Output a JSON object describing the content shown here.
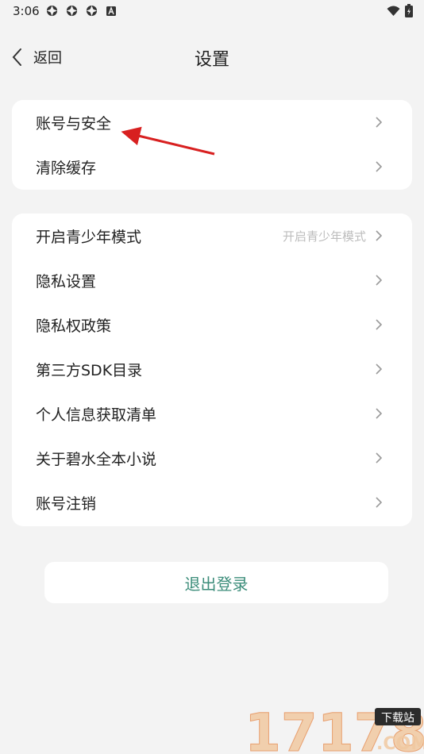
{
  "status": {
    "time": "3:06",
    "icons": [
      "notification-icon",
      "notification-icon",
      "notification-icon",
      "a-icon",
      "wifi-icon",
      "battery-icon"
    ]
  },
  "header": {
    "back_label": "返回",
    "title": "设置"
  },
  "group1": {
    "items": [
      {
        "label": "账号与安全"
      },
      {
        "label": "清除缓存"
      }
    ]
  },
  "group2": {
    "items": [
      {
        "label": "开启青少年模式",
        "value": "开启青少年模式"
      },
      {
        "label": "隐私设置"
      },
      {
        "label": "隐私权政策"
      },
      {
        "label": "第三方SDK目录"
      },
      {
        "label": "个人信息获取清单"
      },
      {
        "label": "关于碧水全本小说"
      },
      {
        "label": "账号注销"
      }
    ]
  },
  "logout": {
    "label": "退出登录"
  },
  "colors": {
    "background": "#f3f3f3",
    "card": "#ffffff",
    "accent": "#3c8d7a",
    "annotation_arrow": "#d82020"
  },
  "watermark": {
    "text": "17178",
    "badge": "下载站",
    "suffix": ".COM"
  }
}
